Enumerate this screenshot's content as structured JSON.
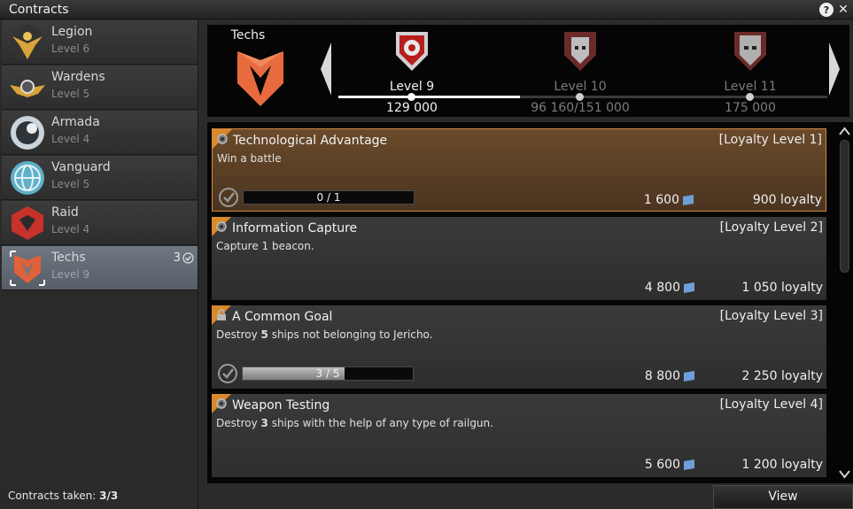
{
  "window": {
    "title": "Contracts"
  },
  "factions": [
    {
      "name": "Legion",
      "level": "Level 6",
      "icon": "legion-eagle-icon"
    },
    {
      "name": "Wardens",
      "level": "Level 5",
      "icon": "wardens-wings-icon"
    },
    {
      "name": "Armada",
      "level": "Level 4",
      "icon": "armada-planet-icon"
    },
    {
      "name": "Vanguard",
      "level": "Level 5",
      "icon": "vanguard-globe-icon"
    },
    {
      "name": "Raid",
      "level": "Level 4",
      "icon": "raid-hex-icon"
    },
    {
      "name": "Techs",
      "level": "Level 9",
      "icon": "techs-shield-icon",
      "badge": "3"
    }
  ],
  "sidebar": {
    "contracts_taken_label": "Contracts taken:",
    "contracts_taken_value": "3/3"
  },
  "header": {
    "faction_name": "Techs",
    "ranks": [
      {
        "label": "Level 9",
        "value": "129 000",
        "icon": "rank-level-9-icon"
      },
      {
        "label": "Level 10",
        "value": "96 160/151 000",
        "icon": "rank-level-10-icon"
      },
      {
        "label": "Level 11",
        "value": "175 000",
        "icon": "rank-level-11-icon"
      }
    ],
    "progress_fraction": 0.37
  },
  "contracts": [
    {
      "title": "Technological Advantage",
      "requirement": "[Loyalty Level 1]",
      "desc_plain": "Win a battle",
      "progress_text": "0 / 1",
      "progress_fraction": 0,
      "credits": "1 600",
      "loyalty": "900 loyalty",
      "selected": true
    },
    {
      "title": "Information Capture",
      "requirement": "[Loyalty Level 2]",
      "desc_plain": "Capture 1 beacon.",
      "credits": "4 800",
      "loyalty": "1 050 loyalty"
    },
    {
      "title": "A Common Goal",
      "requirement": "[Loyalty Level 3]",
      "desc_pre": "Destroy ",
      "desc_num": "5",
      "desc_post": " ships not belonging to Jericho.",
      "progress_text": "3 / 5",
      "progress_fraction": 0.6,
      "credits": "8 800",
      "loyalty": "2 250 loyalty"
    },
    {
      "title": "Weapon Testing",
      "requirement": "[Loyalty Level 4]",
      "desc_pre": "Destroy ",
      "desc_num": "3",
      "desc_post": " ships with the help of any type of railgun.",
      "credits": "5 600",
      "loyalty": "1 200 loyalty"
    }
  ],
  "buttons": {
    "view": "View"
  },
  "colors": {
    "accent": "#d9892a",
    "selected_border": "#d18a45",
    "sidebar_active": "#6f7882"
  }
}
